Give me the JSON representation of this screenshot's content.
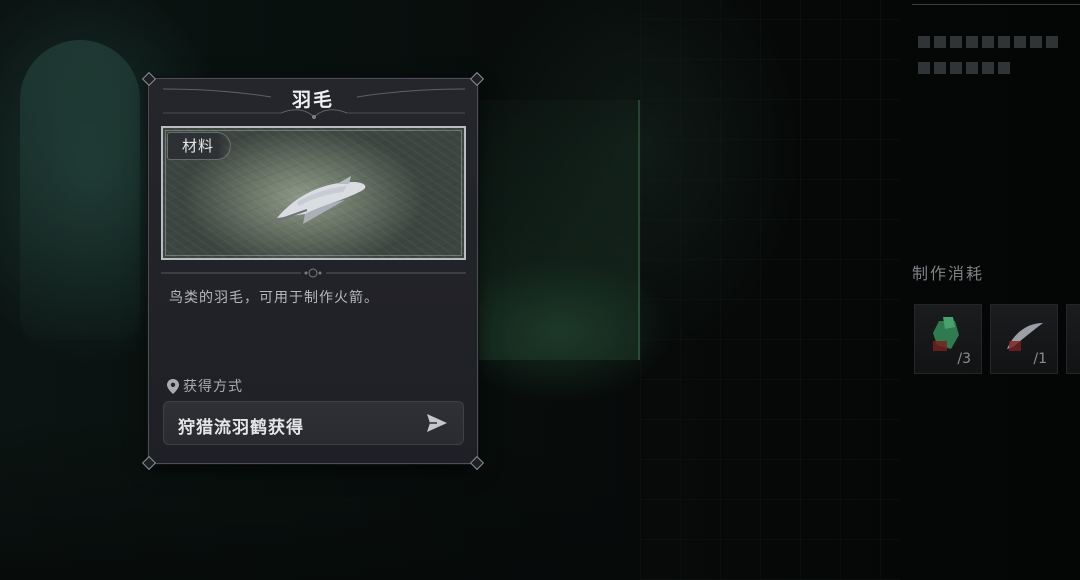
{
  "item": {
    "name": "羽毛",
    "category_tag": "材料",
    "description": "鸟类的羽毛，可用于制作火箭。",
    "image_icon": "feather-icon"
  },
  "source": {
    "label": "获得方式",
    "label_icon": "location-pin-icon",
    "entry": "狩猎流羽鹤获得",
    "entry_icon": "send-arrow-icon"
  },
  "crafting": {
    "title": "制作消耗",
    "materials": [
      {
        "icon": "green-material-icon",
        "count": "/3"
      },
      {
        "icon": "feather-icon",
        "count": "/1"
      }
    ]
  },
  "colors": {
    "card_bg": "#23242a",
    "card_border": "#4c4e55",
    "text_primary": "#eef0f2",
    "text_secondary": "#b4b8bc"
  }
}
